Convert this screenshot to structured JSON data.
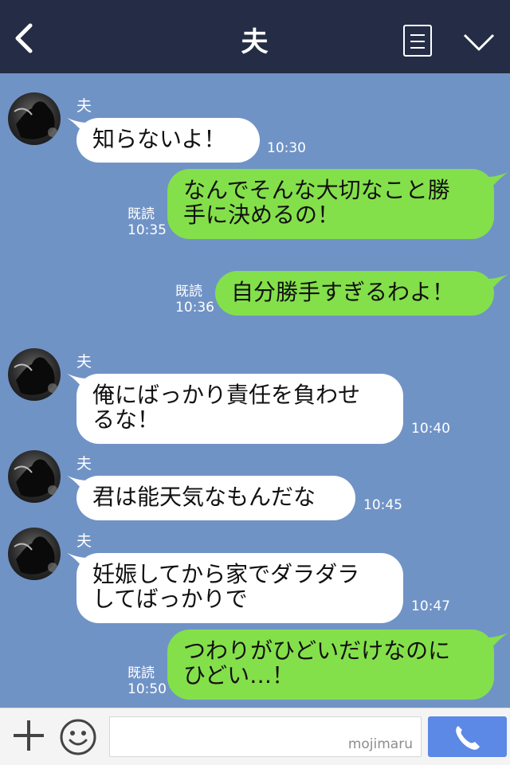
{
  "header": {
    "title": "夫"
  },
  "messages": [
    {
      "from": "in",
      "sender": "夫",
      "lines": [
        "知らないよ！"
      ],
      "time": "10:30"
    },
    {
      "from": "out",
      "read": "既読",
      "lines": [
        "なんでそんな大切なこと勝",
        "手に決めるの！"
      ],
      "time": "10:35"
    },
    {
      "from": "out",
      "read": "既読",
      "lines": [
        "自分勝手すぎるわよ！"
      ],
      "time": "10:36"
    },
    {
      "from": "in",
      "sender": "夫",
      "lines": [
        "俺にばっかり責任を負わせ",
        "るな！"
      ],
      "time": "10:40"
    },
    {
      "from": "in",
      "sender": "夫",
      "lines": [
        "君は能天気なもんだな"
      ],
      "time": "10:45"
    },
    {
      "from": "in",
      "sender": "夫",
      "lines": [
        "妊娠してから家でダラダラ",
        "してばっかりで"
      ],
      "time": "10:47"
    },
    {
      "from": "out",
      "read": "既読",
      "lines": [
        "つわりがひどいだけなのに",
        "ひどい…！"
      ],
      "time": "10:50"
    }
  ],
  "input": {
    "watermark": "mojimaru"
  },
  "icons": [
    "back-icon",
    "menu-icon",
    "chevron-down-icon",
    "plus-icon",
    "smile-icon",
    "phone-icon"
  ],
  "colors": {
    "header": "#242d45",
    "background": "#7093c6",
    "outgoing": "#84e04a",
    "incoming": "#ffffff",
    "call": "#5c88e6"
  }
}
